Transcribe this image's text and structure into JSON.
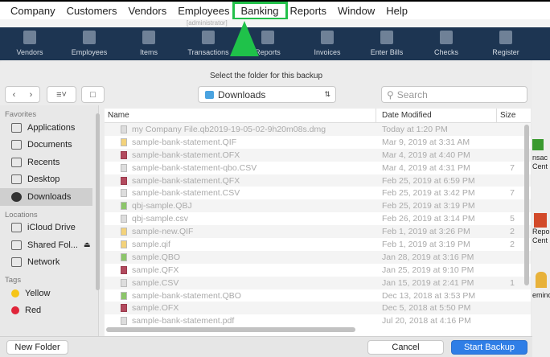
{
  "menubar": [
    "Company",
    "Customers",
    "Vendors",
    "Employees",
    "Banking",
    "Reports",
    "Window",
    "Help"
  ],
  "title_fragment": "[administrator]",
  "toolbar": [
    "Vendors",
    "Employees",
    "Items",
    "Transactions",
    "Reports",
    "Invoices",
    "Enter Bills",
    "Checks",
    "Register"
  ],
  "dialog": {
    "title": "Select the folder for this backup",
    "location": "Downloads",
    "search_placeholder": "Search",
    "sidebar": {
      "favorites_label": "Favorites",
      "favorites": [
        "Applications",
        "Documents",
        "Recents",
        "Desktop",
        "Downloads"
      ],
      "locations_label": "Locations",
      "locations": [
        "iCloud Drive",
        "Shared Fol...",
        "Network"
      ],
      "tags_label": "Tags",
      "tags": [
        {
          "label": "Yellow",
          "color": "#f5c518"
        },
        {
          "label": "Red",
          "color": "#e0253a"
        }
      ]
    },
    "columns": {
      "name": "Name",
      "date": "Date Modified",
      "size": "Size"
    },
    "files": [
      {
        "name": "my Company File.qb2019-19-05-02-9h20m08s.dmg",
        "date": "Today at 1:20 PM",
        "size": "",
        "icon": "doc"
      },
      {
        "name": "sample-bank-statement.QIF",
        "date": "Mar 9, 2019 at 3:31 AM",
        "size": "",
        "icon": "y"
      },
      {
        "name": "sample-bank-statement.OFX",
        "date": "Mar 4, 2019 at 4:40 PM",
        "size": "",
        "icon": "q"
      },
      {
        "name": "sample-bank-statement-qbo.CSV",
        "date": "Mar 4, 2019 at 4:31 PM",
        "size": "7",
        "icon": "doc"
      },
      {
        "name": "sample-bank-statement.QFX",
        "date": "Feb 25, 2019 at 6:59 PM",
        "size": "",
        "icon": "q"
      },
      {
        "name": "sample-bank-statement.CSV",
        "date": "Feb 25, 2019 at 3:42 PM",
        "size": "7",
        "icon": "doc"
      },
      {
        "name": "qbj-sample.QBJ",
        "date": "Feb 25, 2019 at 3:19 PM",
        "size": "",
        "icon": "g"
      },
      {
        "name": "qbj-sample.csv",
        "date": "Feb 26, 2019 at 3:14 PM",
        "size": "5",
        "icon": "doc"
      },
      {
        "name": "sample-new.QIF",
        "date": "Feb 1, 2019 at 3:26 PM",
        "size": "2",
        "icon": "y"
      },
      {
        "name": "sample.qif",
        "date": "Feb 1, 2019 at 3:19 PM",
        "size": "2",
        "icon": "y"
      },
      {
        "name": "sample.QBO",
        "date": "Jan 28, 2019 at 3:16 PM",
        "size": "",
        "icon": "g"
      },
      {
        "name": "sample.QFX",
        "date": "Jan 25, 2019 at 9:10 PM",
        "size": "",
        "icon": "q"
      },
      {
        "name": "sample.CSV",
        "date": "Jan 15, 2019 at 2:41 PM",
        "size": "1",
        "icon": "doc"
      },
      {
        "name": "sample-bank-statement.QBO",
        "date": "Dec 13, 2018 at 3:53 PM",
        "size": "",
        "icon": "g"
      },
      {
        "name": "sample.OFX",
        "date": "Dec 5, 2018 at 5:50 PM",
        "size": "",
        "icon": "q"
      },
      {
        "name": "sample-bank-statement.pdf",
        "date": "Jul 20, 2018 at 4:16 PM",
        "size": "",
        "icon": "doc"
      }
    ],
    "new_folder": "New Folder",
    "cancel": "Cancel",
    "start_backup": "Start Backup"
  },
  "right_panel": [
    "nsac",
    "Cent",
    "Repo",
    "Cent",
    "eminc"
  ]
}
